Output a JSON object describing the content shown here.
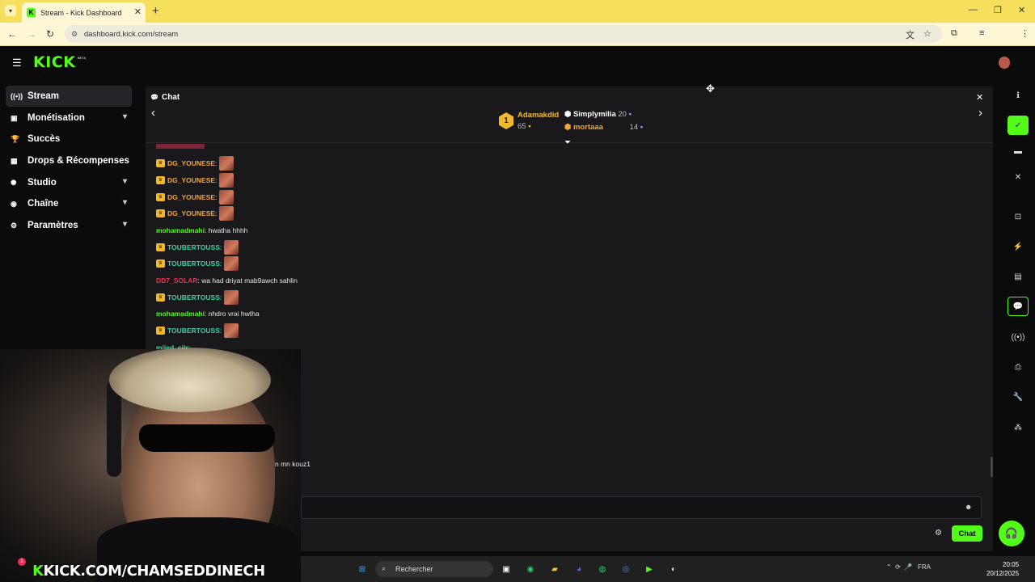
{
  "browser": {
    "tab_title": "Stream - Kick Dashboard",
    "url": "dashboard.kick.com/stream"
  },
  "header": {
    "logo": "KICK",
    "beta": "BETA"
  },
  "sidebar": {
    "items": [
      {
        "label": "Stream",
        "icon": "broadcast-icon"
      },
      {
        "label": "Monétisation",
        "icon": "dollar-icon"
      },
      {
        "label": "Succès",
        "icon": "trophy-icon"
      },
      {
        "label": "Drops & Récompenses",
        "icon": "gift-icon"
      },
      {
        "label": "Studio",
        "icon": "palette-icon"
      },
      {
        "label": "Chaîne",
        "icon": "channel-icon"
      },
      {
        "label": "Paramètres",
        "icon": "gear-icon"
      }
    ]
  },
  "chat": {
    "title": "Chat",
    "leaderboard": {
      "rank": "1",
      "first": {
        "name": "Adamakdid",
        "count": "65"
      },
      "second": {
        "name": "Simplymilia",
        "count": "20"
      },
      "third": {
        "name": "mortaaa",
        "count": "14"
      }
    },
    "messages": [
      {
        "user": "DG_YOUNESE",
        "text": ":",
        "color": "#f2a53a"
      },
      {
        "user": "DG_YOUNESE",
        "text": ":",
        "color": "#f2a53a"
      },
      {
        "user": "DG_YOUNESE",
        "text": ":",
        "color": "#f2a53a"
      },
      {
        "user": "DG_YOUNESE",
        "text": ":",
        "color": "#f2a53a"
      },
      {
        "user": "mohamadmahi",
        "text": ": hwatha hhhh",
        "color": "#53fc18"
      },
      {
        "user": "TOUBERTOUSS",
        "text": ":",
        "color": "#31d6a4"
      },
      {
        "user": "TOUBERTOUSS",
        "text": ":",
        "color": "#31d6a4"
      },
      {
        "user": "DD7_SOLAR",
        "text": ": wa had driyat mab9awch sahlin",
        "color": "#e53058"
      },
      {
        "user": "TOUBERTOUSS",
        "text": ":",
        "color": "#31d6a4"
      },
      {
        "user": "mohamadmahi",
        "text": ": nhdro vrai hwtha",
        "color": "#53fc18"
      },
      {
        "user": "TOUBERTOUSS",
        "text": ":",
        "color": "#31d6a4"
      },
      {
        "user": "mjied_cilr",
        "text": ":",
        "color": "#31d6a4"
      }
    ],
    "partial_message": "n mn kouz1",
    "send_label": "Chat"
  },
  "overlay": {
    "brand_letter": "K",
    "channel_text": "KICK.COM/CHAMSEDDINECH"
  },
  "taskbar": {
    "search_placeholder": "Rechercher",
    "language": "FRA",
    "time": "20:05",
    "date": "20/12/2025",
    "notif_count": "1"
  },
  "colors": {
    "accent": "#53fc18",
    "panel": "#19191b",
    "background": "#0b0b0c"
  }
}
